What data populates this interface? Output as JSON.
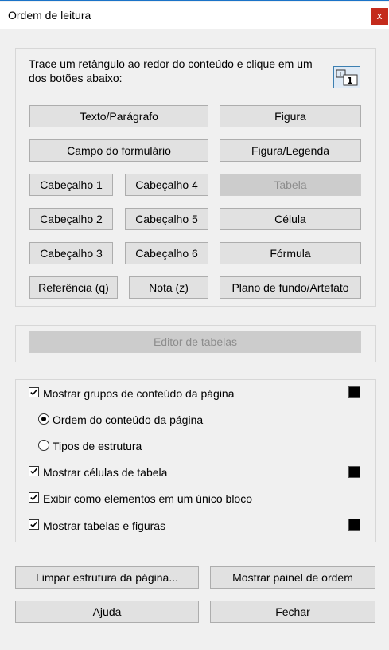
{
  "window": {
    "title": "Ordem de leitura",
    "close_label": "x"
  },
  "tagging": {
    "instruction": "Trace um retângulo ao redor do conteúdo e clique em um dos botões abaixo:",
    "select_tool_icon": "structure-select-icon",
    "buttons": {
      "text_paragraph": "Texto/Parágrafo",
      "figure": "Figura",
      "form_field": "Campo do formulário",
      "figure_caption": "Figura/Legenda",
      "heading1": "Cabeçalho 1",
      "heading4": "Cabeçalho 4",
      "table": "Tabela",
      "heading2": "Cabeçalho 2",
      "heading5": "Cabeçalho 5",
      "cell": "Célula",
      "heading3": "Cabeçalho 3",
      "heading6": "Cabeçalho 6",
      "formula": "Fórmula",
      "reference": "Referência (q)",
      "note": "Nota (z)",
      "background_artifact": "Plano de fundo/Artefato"
    },
    "disabled": [
      "table"
    ]
  },
  "table_editor": {
    "label": "Editor de tabelas",
    "enabled": false
  },
  "display_options": {
    "show_content_groups": {
      "label": "Mostrar grupos de conteúdo da página",
      "checked": true,
      "color": "#000000"
    },
    "radio_page_order": {
      "label": "Ordem do conteúdo da página",
      "selected": true
    },
    "radio_structure_types": {
      "label": "Tipos de estrutura",
      "selected": false
    },
    "show_table_cells": {
      "label": "Mostrar células de tabela",
      "checked": true,
      "color": "#000000"
    },
    "display_inline_blocks": {
      "label": "Exibir como elementos em um único bloco",
      "checked": true
    },
    "show_tables_figures": {
      "label": "Mostrar tabelas e figuras",
      "checked": true,
      "color": "#000000"
    }
  },
  "footer": {
    "clear_structure": "Limpar estrutura da página...",
    "show_order_panel": "Mostrar painel de ordem",
    "help": "Ajuda",
    "close": "Fechar"
  },
  "colors": {
    "close_button": "#c42b1c",
    "dialog_background": "#f0f0f0",
    "button_face": "#e1e1e1",
    "disabled_text": "#8d8d8d"
  }
}
